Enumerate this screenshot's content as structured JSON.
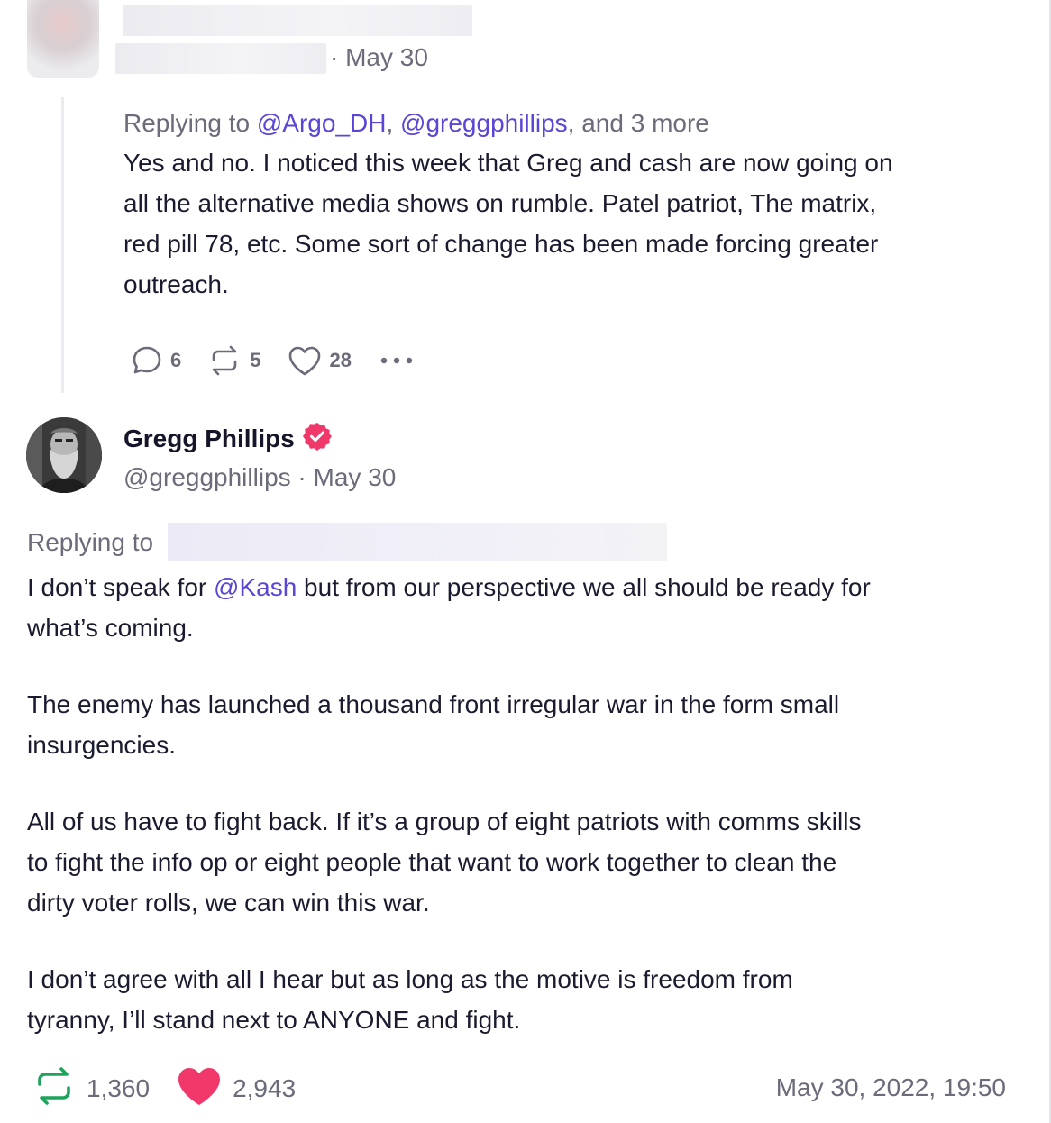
{
  "reply_post": {
    "date": "May 30",
    "replying_to": {
      "prefix": "Replying to",
      "handle_1": "@Argo_DH",
      "handle_2": "@greggphillips",
      "more": "and 3 more"
    },
    "body_lines": [
      "Yes and no. I noticed this week that Greg and cash are now going on",
      "all the alternative media shows on rumble. Patel patriot, The matrix,",
      "red pill 78, etc. Some sort of change has been made forcing greater",
      "outreach."
    ],
    "actions": {
      "replies": "6",
      "reposts": "5",
      "likes": "28"
    }
  },
  "main_post": {
    "author_name": "Gregg Phillips",
    "handle": "@greggphillips",
    "date": "May 30",
    "replying_to_prefix": "Replying to",
    "para1": {
      "pre": "I don’t speak for",
      "mention": "@Kash",
      "post": "but from our perspective we all should be ready for",
      "line2": "what’s coming."
    },
    "para2_lines": [
      "The enemy has launched a thousand front irregular war in the form small",
      "insurgencies."
    ],
    "para3_lines": [
      "All of us have to fight back. If it’s a group of eight patriots with comms skills",
      "to fight the info op or eight people that want to work together to clean the",
      "dirty voter rolls, we can win this war."
    ],
    "para4_lines": [
      "I don’t agree with all I hear but as long as the motive is freedom from",
      "tyranny, I’ll stand next to ANYONE and fight."
    ],
    "stats": {
      "reposts": "1,360",
      "likes": "2,943"
    },
    "timestamp": "May 30, 2022, 19:50"
  },
  "colors": {
    "link": "#5a45d6",
    "verified_badge": "#f0386b",
    "like_heart": "#f0386b",
    "repost_green": "#1fa35c"
  }
}
